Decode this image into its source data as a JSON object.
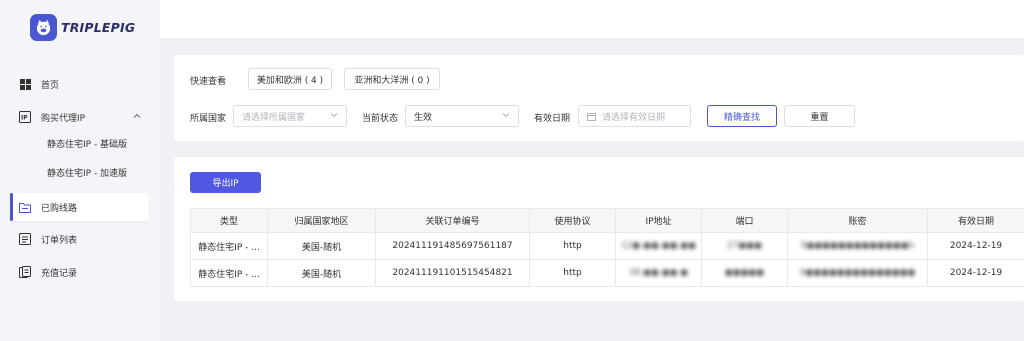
{
  "brand": {
    "name": "TRIPLEPIG",
    "logo_color": "#4b56d2"
  },
  "sidebar": {
    "items": [
      {
        "label": "首页",
        "icon": "dashboard-icon"
      },
      {
        "label": "购买代理IP",
        "icon": "ip-icon",
        "expanded": true,
        "children": [
          {
            "label": "静态住宅IP - 基础版"
          },
          {
            "label": "静态住宅IP - 加速版"
          }
        ]
      },
      {
        "label": "已购线路",
        "icon": "folder-icon",
        "active": true
      },
      {
        "label": "订单列表",
        "icon": "order-list-icon"
      },
      {
        "label": "充值记录",
        "icon": "recharge-icon"
      }
    ]
  },
  "filters": {
    "quick_label": "快速查看",
    "quick_buttons": [
      "美加和欧洲 ( 4 )",
      "亚洲和大洋洲 ( 0 )"
    ],
    "country_label": "所属国家",
    "country_placeholder": "请选择所属国家",
    "status_label": "当前状态",
    "status_value": "生效",
    "date_label": "有效日期",
    "date_placeholder": "请选择有效日期",
    "search_button": "精确查找",
    "reset_button": "重置"
  },
  "export_button": "导出IP",
  "table": {
    "columns": [
      "类型",
      "归属国家地区",
      "关联订单编号",
      "使用协议",
      "IP地址",
      "端口",
      "账密",
      "有效日期"
    ],
    "rows": [
      [
        "静态住宅IP - ...",
        "美国-随机",
        "20241119148569756​1187",
        "http",
        "12●.●●.●●.●●",
        "27●●●",
        "9●●●●●●●●●●●●●b",
        "2024-12-19"
      ],
      [
        "静态住宅IP - ...",
        "美国-随机",
        "20241119110151545​4821",
        "http",
        "38.●●.●●.●",
        "●●●●●",
        "9●●●●●●●●●●●●●●",
        "2024-12-19"
      ]
    ],
    "blurred_columns": [
      4,
      5,
      6
    ]
  },
  "colors": {
    "accent": "#4b56d2",
    "export_button": "#5057e0",
    "page_bg": "#f0f1f5"
  }
}
